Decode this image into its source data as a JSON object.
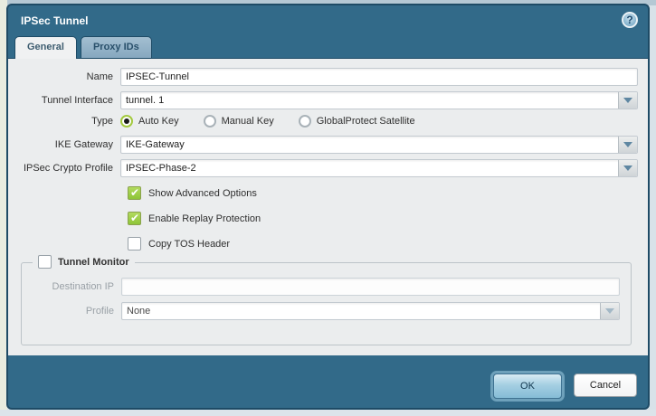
{
  "dialog": {
    "title": "IPSec Tunnel",
    "help_icon": "?",
    "tabs": [
      {
        "label": "General",
        "active": true
      },
      {
        "label": "Proxy IDs",
        "active": false
      }
    ],
    "form": {
      "name": {
        "label": "Name",
        "value": "IPSEC-Tunnel"
      },
      "tunnel_interface": {
        "label": "Tunnel Interface",
        "value": "tunnel. 1"
      },
      "type": {
        "label": "Type",
        "options": [
          {
            "label": "Auto Key",
            "selected": true
          },
          {
            "label": "Manual Key",
            "selected": false
          },
          {
            "label": "GlobalProtect Satellite",
            "selected": false
          }
        ]
      },
      "ike_gateway": {
        "label": "IKE Gateway",
        "value": "IKE-Gateway"
      },
      "ipsec_crypto_profile": {
        "label": "IPSec Crypto Profile",
        "value": "IPSEC-Phase-2"
      },
      "checkboxes": [
        {
          "label": "Show Advanced Options",
          "checked": true
        },
        {
          "label": "Enable Replay Protection",
          "checked": true
        },
        {
          "label": "Copy TOS Header",
          "checked": false
        }
      ],
      "tunnel_monitor": {
        "label": "Tunnel Monitor",
        "checked": false,
        "destination_ip": {
          "label": "Destination IP",
          "value": ""
        },
        "profile": {
          "label": "Profile",
          "value": "None"
        }
      }
    },
    "buttons": {
      "ok": "OK",
      "cancel": "Cancel"
    }
  },
  "colors": {
    "dialog_teal": "#326a89",
    "dialog_border": "#1e4b66",
    "panel_gray": "#ebedee",
    "checkbox_green": "#8ec537",
    "radio_green": "#a3c93e",
    "ok_button_blue": "#a5cfe2"
  }
}
